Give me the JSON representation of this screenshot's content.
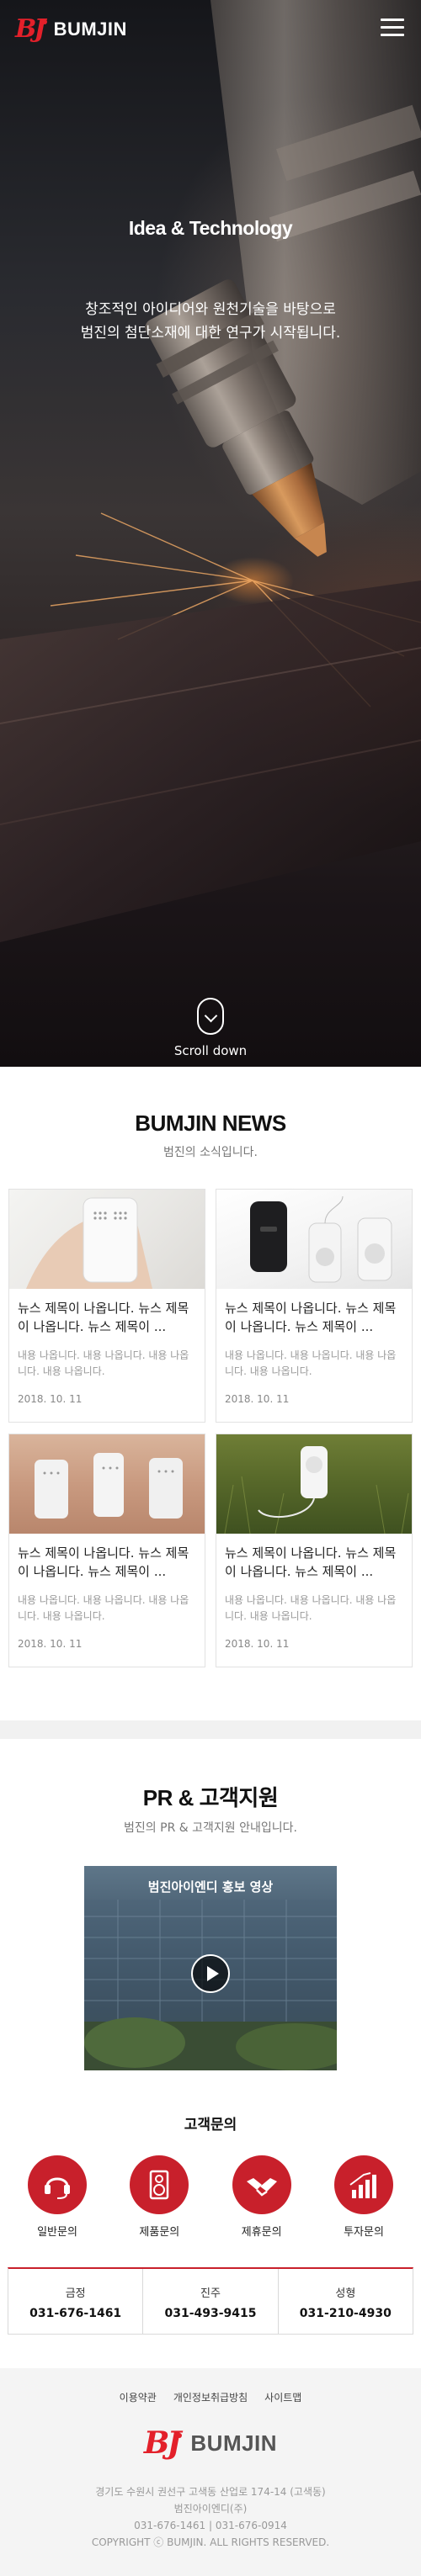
{
  "header": {
    "logo_mark": "BJ",
    "logo_text": "BUMJIN"
  },
  "hero": {
    "title": "Idea & Technology",
    "subtitle_line1": "창조적인 아이디어와 원천기술을 바탕으로",
    "subtitle_line2": "범진의 첨단소재에 대한 연구가 시작됩니다.",
    "scroll_label": "Scroll down"
  },
  "news": {
    "title": "BUMJIN NEWS",
    "subtitle": "범진의 소식입니다.",
    "items": [
      {
        "title": "뉴스 제목이 나옵니다. 뉴스 제목이 나옵니다. 뉴스 제목이 ...",
        "text": "내용 나옵니다. 내용 나옵니다. 내용 나옵니다. 내용 나옵니다.",
        "date": "2018. 10. 11"
      },
      {
        "title": "뉴스 제목이 나옵니다. 뉴스 제목이 나옵니다. 뉴스 제목이 ...",
        "text": "내용 나옵니다. 내용 나옵니다. 내용 나옵니다. 내용 나옵니다.",
        "date": "2018. 10. 11"
      },
      {
        "title": "뉴스 제목이 나옵니다. 뉴스 제목이 나옵니다. 뉴스 제목이 ...",
        "text": "내용 나옵니다. 내용 나옵니다. 내용 나옵니다. 내용 나옵니다.",
        "date": "2018. 10. 11"
      },
      {
        "title": "뉴스 제목이 나옵니다. 뉴스 제목이 나옵니다. 뉴스 제목이 ...",
        "text": "내용 나옵니다. 내용 나옵니다. 내용 나옵니다. 내용 나옵니다.",
        "date": "2018. 10. 11"
      }
    ]
  },
  "pr": {
    "title": "PR & 고객지원",
    "subtitle": "범진의 PR & 고객지원 안내입니다.",
    "video_title": "범진아이엔디 홍보 영상",
    "support_title": "고객문의",
    "support_items": [
      {
        "label": "일반문의",
        "icon": "headset-icon"
      },
      {
        "label": "제품문의",
        "icon": "speaker-icon"
      },
      {
        "label": "제휴문의",
        "icon": "handshake-icon"
      },
      {
        "label": "투자문의",
        "icon": "growth-chart-icon"
      }
    ],
    "phones": [
      {
        "city": "금정",
        "number": "031-676-1461"
      },
      {
        "city": "진주",
        "number": "031-493-9415"
      },
      {
        "city": "성형",
        "number": "031-210-4930"
      }
    ]
  },
  "footer": {
    "links": [
      "이용약관",
      "개인정보취급방침",
      "사이트맵"
    ],
    "logo_mark": "BJ",
    "logo_text": "BUMJIN",
    "address": "경기도 수원시 권선구 고색동 산업로 174-14 (고색동)",
    "company": "범진아이엔디(주)",
    "tel": "031-676-1461",
    "fax": "031-676-0914",
    "copyright": "COPYRIGHT ⓒ BUMJIN. ALL RIGHTS RESERVED."
  },
  "colors": {
    "brand_red": "#e3202a",
    "support_red": "#c8202b"
  }
}
